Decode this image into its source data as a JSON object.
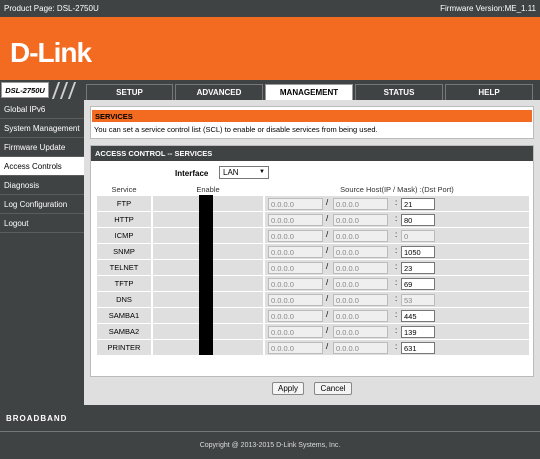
{
  "topbar": {
    "product": "Product Page: DSL-2750U",
    "firmware": "Firmware Version:ME_1.11"
  },
  "brand": {
    "logo": "D-Link"
  },
  "nav": {
    "model": "DSL-2750U",
    "tabs": [
      {
        "label": "SETUP"
      },
      {
        "label": "ADVANCED"
      },
      {
        "label": "MANAGEMENT"
      },
      {
        "label": "STATUS"
      },
      {
        "label": "HELP"
      }
    ]
  },
  "sidebar": {
    "items": [
      {
        "label": "Global IPv6"
      },
      {
        "label": "System Management"
      },
      {
        "label": "Firmware Update"
      },
      {
        "label": "Access Controls"
      },
      {
        "label": "Diagnosis"
      },
      {
        "label": "Log Configuration"
      },
      {
        "label": "Logout"
      }
    ]
  },
  "services": {
    "title": "SERVICES",
    "description": "You can set a service control list (SCL) to enable or disable services from being used."
  },
  "acl": {
    "title": "ACCESS CONTROL -- SERVICES",
    "interface_label": "Interface",
    "interface_value": "LAN",
    "headers": {
      "service": "Service",
      "enable": "Enable",
      "source": "Source Host(IP / Mask) :(Dst Port)"
    },
    "separator": "/",
    "colon": ":",
    "rows": [
      {
        "service": "FTP",
        "ip": "0.0.0.0",
        "mask": "0.0.0.0",
        "port": "21",
        "port_enabled": true
      },
      {
        "service": "HTTP",
        "ip": "0.0.0.0",
        "mask": "0.0.0.0",
        "port": "80",
        "port_enabled": true
      },
      {
        "service": "ICMP",
        "ip": "0.0.0.0",
        "mask": "0.0.0.0",
        "port": "0",
        "port_enabled": false
      },
      {
        "service": "SNMP",
        "ip": "0.0.0.0",
        "mask": "0.0.0.0",
        "port": "1050",
        "port_enabled": true
      },
      {
        "service": "TELNET",
        "ip": "0.0.0.0",
        "mask": "0.0.0.0",
        "port": "23",
        "port_enabled": true
      },
      {
        "service": "TFTP",
        "ip": "0.0.0.0",
        "mask": "0.0.0.0",
        "port": "69",
        "port_enabled": true
      },
      {
        "service": "DNS",
        "ip": "0.0.0.0",
        "mask": "0.0.0.0",
        "port": "53",
        "port_enabled": false
      },
      {
        "service": "SAMBA1",
        "ip": "0.0.0.0",
        "mask": "0.0.0.0",
        "port": "445",
        "port_enabled": true
      },
      {
        "service": "SAMBA2",
        "ip": "0.0.0.0",
        "mask": "0.0.0.0",
        "port": "139",
        "port_enabled": true
      },
      {
        "service": "PRINTER",
        "ip": "0.0.0.0",
        "mask": "0.0.0.0",
        "port": "631",
        "port_enabled": true
      }
    ]
  },
  "actions": {
    "apply": "Apply",
    "cancel": "Cancel"
  },
  "footer": {
    "brand": "BROADBAND",
    "copyright": "Copyright @ 2013-2015 D-Link Systems, Inc."
  },
  "colors": {
    "accent": "#f26b21",
    "dark": "#404343",
    "panel": "#dfdfdf"
  },
  "icons": {
    "interface_dropdown": "triangle-down-icon"
  }
}
